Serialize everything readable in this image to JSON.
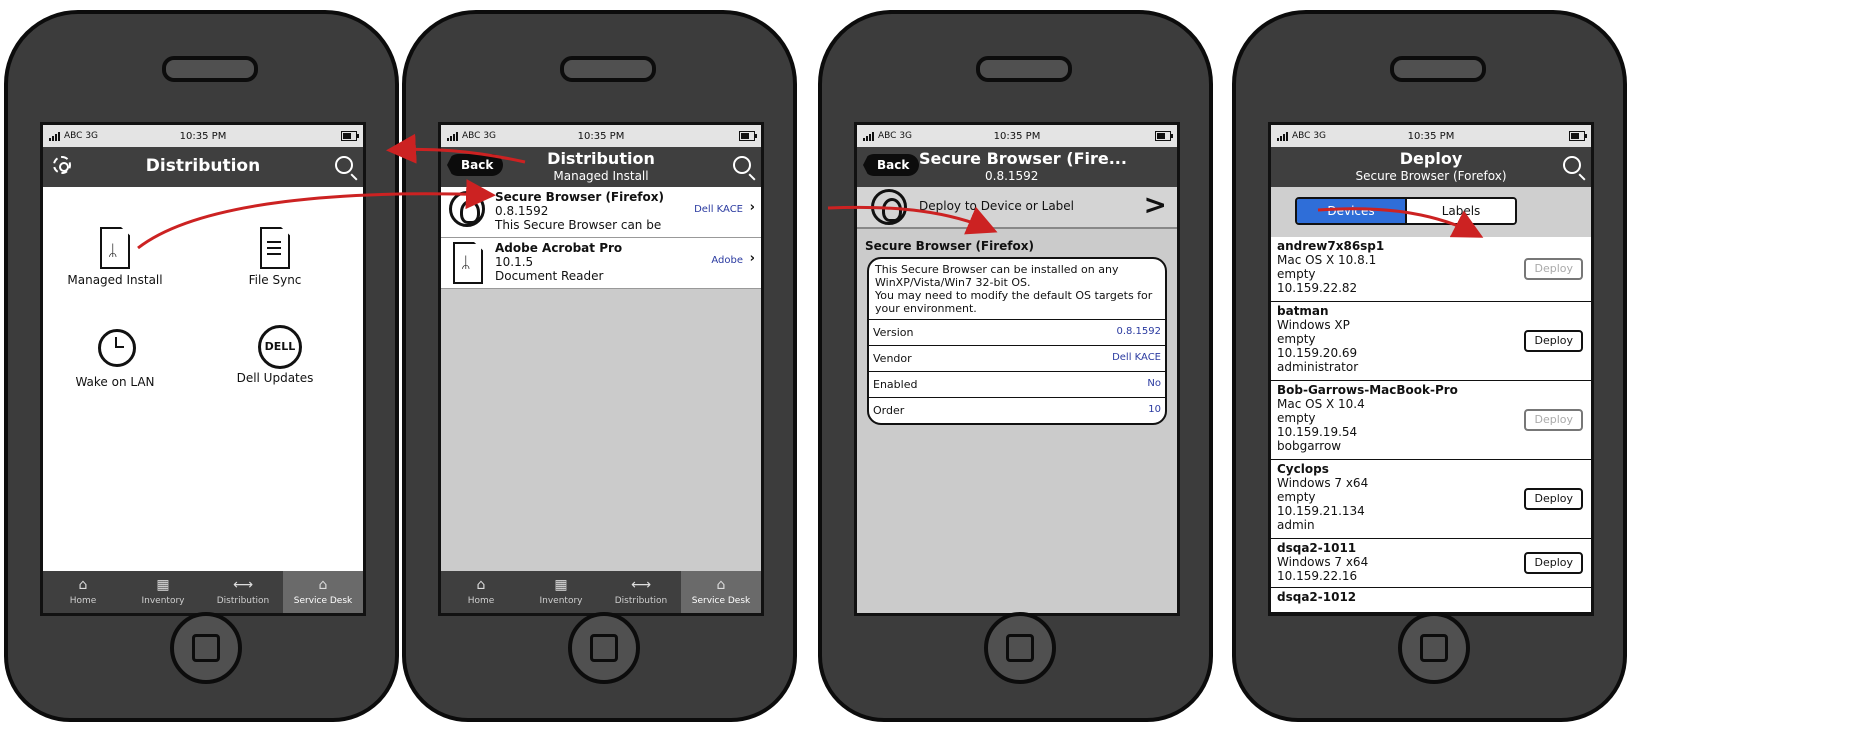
{
  "status": {
    "carrier": "ABC 3G",
    "time": "10:35 PM"
  },
  "phone1": {
    "title": "Distribution",
    "grid": [
      {
        "label": "Managed Install",
        "icon": "pdf-doc-icon"
      },
      {
        "label": "File Sync",
        "icon": "doc-icon"
      },
      {
        "label": "Wake on LAN",
        "icon": "alarm-clock-icon"
      },
      {
        "label": "Dell Updates",
        "icon": "dell-logo-icon",
        "logo_text": "DELL"
      }
    ]
  },
  "tabs": [
    "Home",
    "Inventory",
    "Distribution",
    "Service Desk"
  ],
  "phone2": {
    "back": "Back",
    "title": "Distribution",
    "subtitle": "Managed Install",
    "rows": [
      {
        "name": "Secure Browser (Firefox)",
        "version": "0.8.1592",
        "desc": "This Secure Browser can be",
        "vendor": "Dell KACE"
      },
      {
        "name": "Adobe Acrobat Pro",
        "version": "10.1.5",
        "desc": "Document Reader",
        "vendor": "Adobe"
      }
    ]
  },
  "phone3": {
    "back": "Back",
    "title": "Secure Browser (Fire...",
    "subtitle": "0.8.1592",
    "deploy_label": "Deploy to Device or Label",
    "section": "Secure Browser (Firefox)",
    "description": "This Secure Browser can be installed on any WinXP/Vista/Win7 32-bit OS.\nYou may need to modify the default OS targets for your environment.",
    "fields": [
      {
        "k": "Version",
        "v": "0.8.1592"
      },
      {
        "k": "Vendor",
        "v": "Dell KACE"
      },
      {
        "k": "Enabled",
        "v": "No"
      },
      {
        "k": "Order",
        "v": "10"
      }
    ]
  },
  "phone4": {
    "title": "Deploy",
    "subtitle": "Secure Browser (Forefox)",
    "segments": [
      "Devices",
      "Labels"
    ],
    "deploy": "Deploy",
    "devices": [
      {
        "name": "andrew7x86sp1",
        "os": "Mac OS X 10.8.1",
        "l3": "empty",
        "ip": "10.159.22.82",
        "user": ""
      },
      {
        "name": "batman",
        "os": "Windows XP",
        "l3": "empty",
        "ip": "10.159.20.69",
        "user": "administrator"
      },
      {
        "name": "Bob-Garrows-MacBook-Pro",
        "os": "Mac OS X 10.4",
        "l3": "empty",
        "ip": "10.159.19.54",
        "user": "bobgarrow"
      },
      {
        "name": "Cyclops",
        "os": "Windows 7 x64",
        "l3": "empty",
        "ip": "10.159.21.134",
        "user": "admin"
      },
      {
        "name": "dsqa2-1011",
        "os": "Windows 7 x64",
        "l3": "10.159.22.16",
        "ip": "",
        "user": ""
      },
      {
        "name": "dsqa2-1012",
        "os": "",
        "l3": "",
        "ip": "",
        "user": ""
      }
    ]
  }
}
